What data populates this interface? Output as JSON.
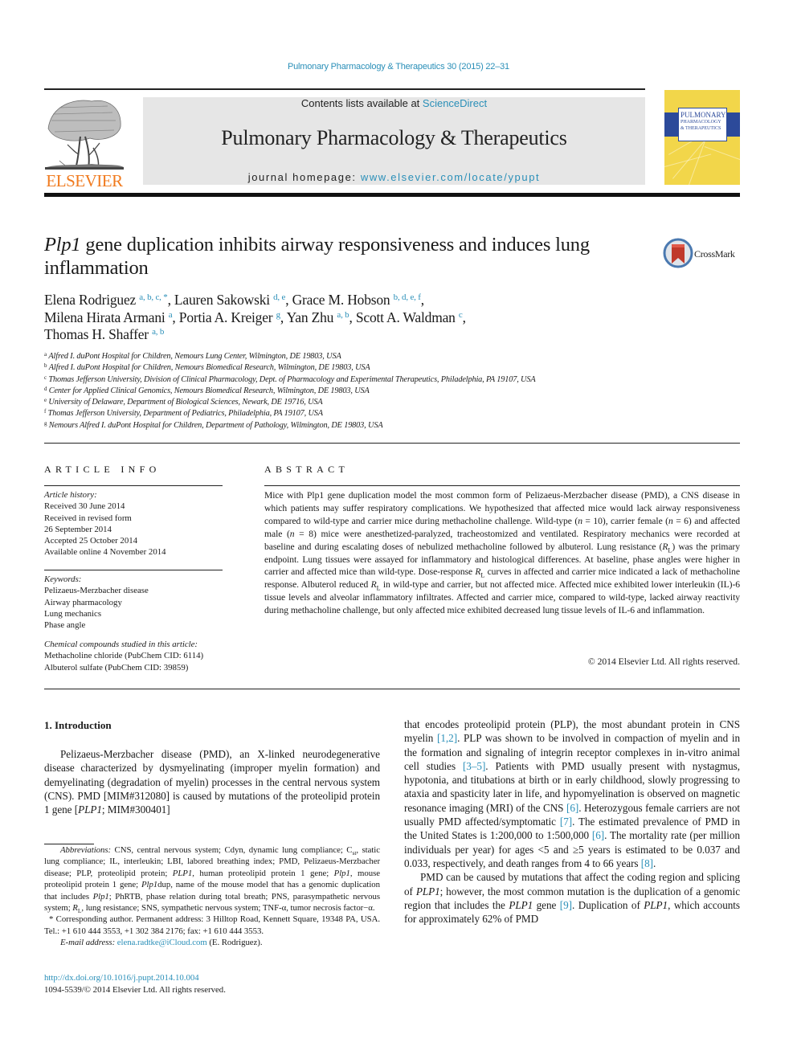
{
  "running_header": "Pulmonary Pharmacology & Therapeutics 30 (2015) 22–31",
  "masthead": {
    "publisher_logo": "ELSEVIER",
    "contents_prefix": "Contents lists available at ",
    "contents_link": "ScienceDirect",
    "journal_title": "Pulmonary Pharmacology & Therapeutics",
    "homepage_prefix": "journal homepage: ",
    "homepage_link": "www.elsevier.com/locate/ypupt",
    "cover_title_lines": [
      "PULMONARY",
      "PHARMACOLOGY",
      "& THERAPEUTICS"
    ]
  },
  "article": {
    "title_italic": "Plp1",
    "title_rest": " gene duplication inhibits airway responsiveness and induces lung inflammation",
    "crossmark_label": "CrossMark",
    "authors": [
      {
        "name": "Elena Rodriguez",
        "sup": "a, b, c, *",
        "sep": ", "
      },
      {
        "name": "Lauren Sakowski",
        "sup": "d, e",
        "sep": ", "
      },
      {
        "name": "Grace M. Hobson",
        "sup": "b, d, e, f",
        "sep": ","
      },
      {
        "name": "Milena Hirata Armani",
        "sup": "a",
        "sep": ", "
      },
      {
        "name": "Portia A. Kreiger",
        "sup": "g",
        "sep": ", "
      },
      {
        "name": "Yan Zhu",
        "sup": "a, b",
        "sep": ", "
      },
      {
        "name": "Scott A. Waldman",
        "sup": "c",
        "sep": ","
      },
      {
        "name": "Thomas H. Shaffer",
        "sup": "a, b",
        "sep": ""
      }
    ],
    "affiliations": [
      {
        "key": "a",
        "text": "Alfred I. duPont Hospital for Children, Nemours Lung Center, Wilmington, DE 19803, USA"
      },
      {
        "key": "b",
        "text": "Alfred I. duPont Hospital for Children, Nemours Biomedical Research, Wilmington, DE 19803, USA"
      },
      {
        "key": "c",
        "text": "Thomas Jefferson University, Division of Clinical Pharmacology, Dept. of Pharmacology and Experimental Therapeutics, Philadelphia, PA 19107, USA"
      },
      {
        "key": "d",
        "text": "Center for Applied Clinical Genomics, Nemours Biomedical Research, Wilmington, DE 19803, USA"
      },
      {
        "key": "e",
        "text": "University of Delaware, Department of Biological Sciences, Newark, DE 19716, USA"
      },
      {
        "key": "f",
        "text": "Thomas Jefferson University, Department of Pediatrics, Philadelphia, PA 19107, USA"
      },
      {
        "key": "g",
        "text": "Nemours Alfred I. duPont Hospital for Children, Department of Pathology, Wilmington, DE 19803, USA"
      }
    ]
  },
  "article_info": {
    "heading": "ARTICLE INFO",
    "history_label": "Article history:",
    "history": [
      "Received 30 June 2014",
      "Received in revised form",
      "26 September 2014",
      "Accepted 25 October 2014",
      "Available online 4 November 2014"
    ],
    "keywords_label": "Keywords:",
    "keywords": [
      "Pelizaeus-Merzbacher disease",
      "Airway pharmacology",
      "Lung mechanics",
      "Phase angle"
    ],
    "chemicals_label": "Chemical compounds studied in this article:",
    "chemicals": [
      "Methacholine chloride (PubChem CID: 6114)",
      "Albuterol sulfate (PubChem CID: 39859)"
    ]
  },
  "abstract": {
    "heading": "ABSTRACT",
    "segments": [
      {
        "t": "Mice with Plp1 gene duplication model the most common form of Pelizaeus-Merzbacher disease (PMD), a CNS disease in which patients may suffer respiratory complications. We hypothesized that affected mice would lack airway responsiveness compared to wild-type and carrier mice during methacholine challenge. Wild-type ("
      },
      {
        "t": "n",
        "i": true
      },
      {
        "t": " = 10), carrier female ("
      },
      {
        "t": "n",
        "i": true
      },
      {
        "t": " = 6) and affected male ("
      },
      {
        "t": "n",
        "i": true
      },
      {
        "t": " = 8) mice were anesthetized-paralyzed, tracheostomized and ventilated. Respiratory mechanics were recorded at baseline and during escalating doses of nebulized methacholine followed by albuterol. Lung resistance ("
      },
      {
        "t": "R",
        "i": true,
        "sub": "L"
      },
      {
        "t": ") was the primary endpoint. Lung tissues were assayed for inflammatory and histological differences. At baseline, phase angles were higher in carrier and affected mice than wild-type. Dose-response "
      },
      {
        "t": "R",
        "i": true,
        "sub": "L"
      },
      {
        "t": " curves in affected and carrier mice indicated a lack of methacholine response. Albuterol reduced "
      },
      {
        "t": "R",
        "i": true,
        "sub": "L"
      },
      {
        "t": " in wild-type and carrier, but not affected mice. Affected mice exhibited lower interleukin (IL)-6 tissue levels and alveolar inflammatory infiltrates. Affected and carrier mice, compared to wild-type, lacked airway reactivity during methacholine challenge, but only affected mice exhibited decreased lung tissue levels of IL-6 and inflammation."
      }
    ],
    "copyright": "© 2014 Elsevier Ltd. All rights reserved."
  },
  "body": {
    "intro_heading": "1.  Introduction",
    "left_column": [
      {
        "t": "Pelizaeus-Merzbacher disease (PMD), an X-linked neurodegenerative disease characterized by dysmyelinating (improper myelin formation) and demyelinating (degradation of myelin) processes in the central nervous system (CNS). PMD [MIM#312080] is caused by mutations of the proteolipid protein 1 gene ["
      },
      {
        "t": "PLP1",
        "i": true
      },
      {
        "t": "; MIM#300401]"
      }
    ],
    "right_para1": [
      {
        "t": "that encodes proteolipid protein (PLP), the most abundant protein in CNS myelin "
      },
      {
        "t": "[1,2]",
        "link": true
      },
      {
        "t": ". PLP was shown to be involved in compaction of myelin and in the formation and signaling of integrin receptor complexes in in-vitro animal cell studies "
      },
      {
        "t": "[3–5]",
        "link": true
      },
      {
        "t": ". Patients with PMD usually present with nystagmus, hypotonia, and titubations at birth or in early childhood, slowly progressing to ataxia and spasticity later in life, and hypomyelination is observed on magnetic resonance imaging (MRI) of the CNS "
      },
      {
        "t": "[6]",
        "link": true
      },
      {
        "t": ". Heterozygous female carriers are not usually PMD affected/symptomatic "
      },
      {
        "t": "[7]",
        "link": true
      },
      {
        "t": ". The estimated prevalence of PMD in the United States is 1:200,000 to 1:500,000 "
      },
      {
        "t": "[6]",
        "link": true
      },
      {
        "t": ". The mortality rate (per million individuals per year) for ages <5 and ≥5 years is estimated to be 0.037 and 0.033, respectively, and death ranges from 4 to 66 years "
      },
      {
        "t": "[8]",
        "link": true
      },
      {
        "t": "."
      }
    ],
    "right_para2": [
      {
        "t": "PMD can be caused by mutations that affect the coding region and splicing of "
      },
      {
        "t": "PLP1",
        "i": true
      },
      {
        "t": "; however, the most common mutation is the duplication of a genomic region that includes the "
      },
      {
        "t": "PLP1",
        "i": true
      },
      {
        "t": " gene "
      },
      {
        "t": "[9]",
        "link": true
      },
      {
        "t": ". Duplication of "
      },
      {
        "t": "PLP1",
        "i": true
      },
      {
        "t": ", which accounts for approximately 62% of PMD"
      }
    ]
  },
  "footnotes": {
    "abbreviations": [
      {
        "t": "Abbreviations:",
        "i": true
      },
      {
        "t": " CNS, central nervous system; Cdyn, dynamic lung compliance; C"
      },
      {
        "t": "st",
        "sub": true
      },
      {
        "t": ", static lung compliance; IL, interleukin; LBI, labored breathing index; PMD, Pelizaeus-Merzbacher disease; PLP, proteolipid protein; "
      },
      {
        "t": "PLP1",
        "i": true
      },
      {
        "t": ", human proteolipid protein 1 gene; "
      },
      {
        "t": "Plp1",
        "i": true
      },
      {
        "t": ", mouse proteolipid protein 1 gene; "
      },
      {
        "t": "Plp1",
        "i": true
      },
      {
        "t": "dup, name of the mouse model that has a genomic duplication that includes "
      },
      {
        "t": "Plp1",
        "i": true
      },
      {
        "t": "; PhRTB, phase relation during total breath; PNS, parasympathetic nervous system; "
      },
      {
        "t": "R",
        "i": true
      },
      {
        "t": "L",
        "sub": true
      },
      {
        "t": ", lung resistance; SNS, sympathetic nervous system; TNF-α, tumor necrosis factor−α."
      }
    ],
    "corresponding": "* Corresponding author. Permanent address: 3 Hilltop Road, Kennett Square, 19348 PA, USA. Tel.: +1 610 444 3553, +1 302 384 2176; fax: +1 610 444 3553.",
    "email_label": "E-mail address:",
    "email": "elena.radtke@iCloud.com",
    "email_suffix": " (E. Rodriguez)."
  },
  "doi": {
    "link": "http://dx.doi.org/10.1016/j.pupt.2014.10.004",
    "issn_line": "1094-5539/© 2014 Elsevier Ltd. All rights reserved."
  },
  "colors": {
    "link": "#2a8fb8",
    "elsevier_orange": "#f07a1e",
    "masthead_gray": "#e6e6e6",
    "cover_yellow": "#f2d64a",
    "cover_blue": "#2c4a9a",
    "crossmark_red": "#c0392b"
  }
}
